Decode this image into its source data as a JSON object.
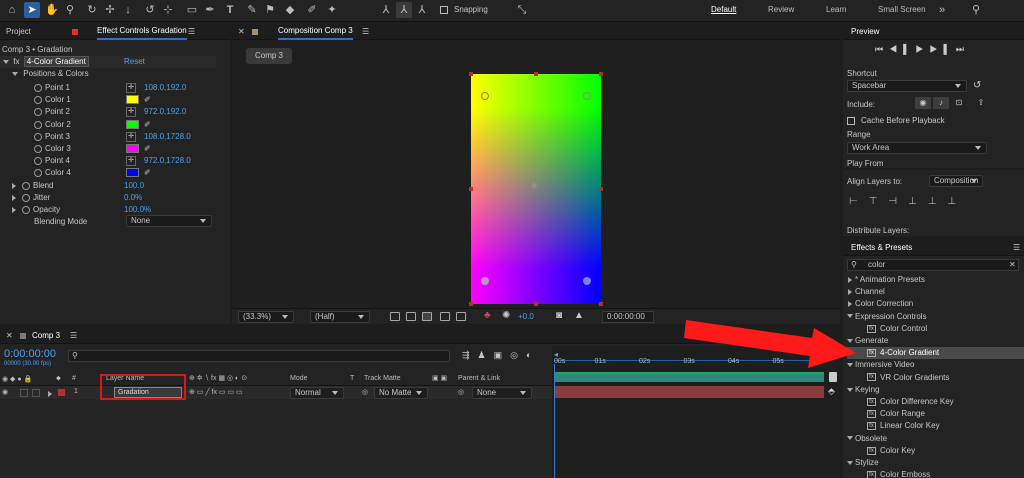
{
  "toolbar": {
    "snapping_label": "Snapping",
    "workspaces": [
      "Default",
      "Review",
      "Learn",
      "Small Screen"
    ]
  },
  "left_panel": {
    "tabs": [
      "Project",
      "Effect Controls Gradation"
    ],
    "breadcrumb": "Comp 3 • Gradation",
    "effect_name": "4-Color Gradient",
    "reset_label": "Reset",
    "group_label": "Positions & Colors",
    "properties": [
      {
        "name": "Point 1",
        "value": "108.0,192.0",
        "kind": "point"
      },
      {
        "name": "Color 1",
        "value": "",
        "kind": "color",
        "color": "#ffff00"
      },
      {
        "name": "Point 2",
        "value": "972.0,192.0",
        "kind": "point"
      },
      {
        "name": "Color 2",
        "value": "",
        "kind": "color",
        "color": "#00ff00"
      },
      {
        "name": "Point 3",
        "value": "108.0,1728.0",
        "kind": "point"
      },
      {
        "name": "Color 3",
        "value": "",
        "kind": "color",
        "color": "#ff00ff"
      },
      {
        "name": "Point 4",
        "value": "972.0,1728.0",
        "kind": "point"
      },
      {
        "name": "Color 4",
        "value": "",
        "kind": "color",
        "color": "#0000ff"
      }
    ],
    "extra": [
      {
        "name": "Blend",
        "value": "100.0"
      },
      {
        "name": "Jitter",
        "value": "0.0%"
      },
      {
        "name": "Opacity",
        "value": "100.0%"
      }
    ],
    "blending_mode_label": "Blending Mode",
    "blending_mode_value": "None"
  },
  "composition": {
    "tab_label": "Composition Comp 3",
    "comp_button": "Comp 3",
    "zoom": "(33.3%)",
    "resolution": "(Half)",
    "exposure": "+0.0",
    "timecode": "0:00:00:00"
  },
  "timeline": {
    "tab_label": "Comp 3",
    "timecode": "0:00:00:00",
    "fps": "00000 (30.00 fps)",
    "columns": {
      "layer_name": "Layer Name",
      "mode": "Mode",
      "track_matte": "Track Matte",
      "parent_link": "Parent & Link",
      "t": "T"
    },
    "layer": {
      "number": "1",
      "name": "Gradation",
      "mode": "Normal",
      "matte": "No Matte",
      "parent": "None"
    },
    "ruler": [
      "00s",
      "01s",
      "02s",
      "03s",
      "04s",
      "05s",
      "06"
    ]
  },
  "preview": {
    "title": "Preview",
    "shortcut_label": "Shortcut",
    "shortcut_value": "Spacebar",
    "include_label": "Include:",
    "cache_label": "Cache Before Playback",
    "range_label": "Range",
    "range_value": "Work Area",
    "play_from": "Play From"
  },
  "align": {
    "label": "Align Layers to:",
    "value": "Composition",
    "distribute_label": "Distribute Layers:"
  },
  "effects_presets": {
    "title": "Effects & Presets",
    "search_value": "color",
    "items": [
      {
        "label": "* Animation Presets",
        "type": "folder-closed",
        "indent": 0
      },
      {
        "label": "Channel",
        "type": "folder-closed",
        "indent": 0
      },
      {
        "label": "Color Correction",
        "type": "folder-closed",
        "indent": 0
      },
      {
        "label": "Expression Controls",
        "type": "folder-open",
        "indent": 0
      },
      {
        "label": "Color Control",
        "type": "effect",
        "indent": 1
      },
      {
        "label": "Generate",
        "type": "folder-open",
        "indent": 0
      },
      {
        "label": "4-Color Gradient",
        "type": "effect-selected",
        "indent": 1
      },
      {
        "label": "Immersive Video",
        "type": "folder-open",
        "indent": 0
      },
      {
        "label": "VR Color Gradients",
        "type": "effect",
        "indent": 1
      },
      {
        "label": "Keying",
        "type": "folder-open",
        "indent": 0
      },
      {
        "label": "Color Difference Key",
        "type": "effect",
        "indent": 1
      },
      {
        "label": "Color Range",
        "type": "effect",
        "indent": 1
      },
      {
        "label": "Linear Color Key",
        "type": "effect",
        "indent": 1
      },
      {
        "label": "Obsolete",
        "type": "folder-open",
        "indent": 0
      },
      {
        "label": "Color Key",
        "type": "effect",
        "indent": 1
      },
      {
        "label": "Stylize",
        "type": "folder-open",
        "indent": 0
      },
      {
        "label": "Color Emboss",
        "type": "effect",
        "indent": 1
      }
    ]
  },
  "annotation": {
    "arrow_color": "#ff1a1a",
    "highlight_color": "#e01515"
  }
}
